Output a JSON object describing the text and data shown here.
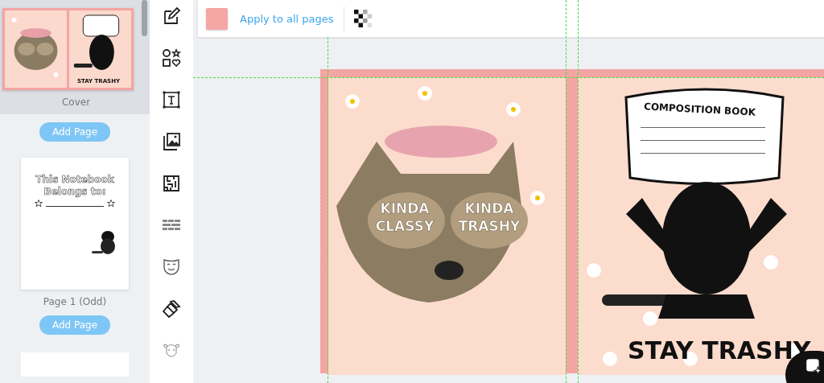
{
  "pages_panel": {
    "items": [
      {
        "kind": "cover",
        "label": "Cover",
        "selected": true,
        "thumb_text": "STAY TRASHY"
      },
      {
        "kind": "add",
        "label": "Add Page"
      },
      {
        "kind": "page",
        "label": "Page 1 (Odd)",
        "selected": false,
        "thumb_text": "This Notebook Belongs to:"
      },
      {
        "kind": "add",
        "label": "Add Page"
      },
      {
        "kind": "stub"
      }
    ]
  },
  "top_bar": {
    "apply_label": "Apply to all pages"
  },
  "canvas": {
    "front": {
      "glasses_left": "KINDA CLASSY",
      "glasses_right": "KINDA TRASHY"
    },
    "back": {
      "label_title": "COMPOSITION BOOK",
      "caption": "STAY TRASHY"
    }
  }
}
